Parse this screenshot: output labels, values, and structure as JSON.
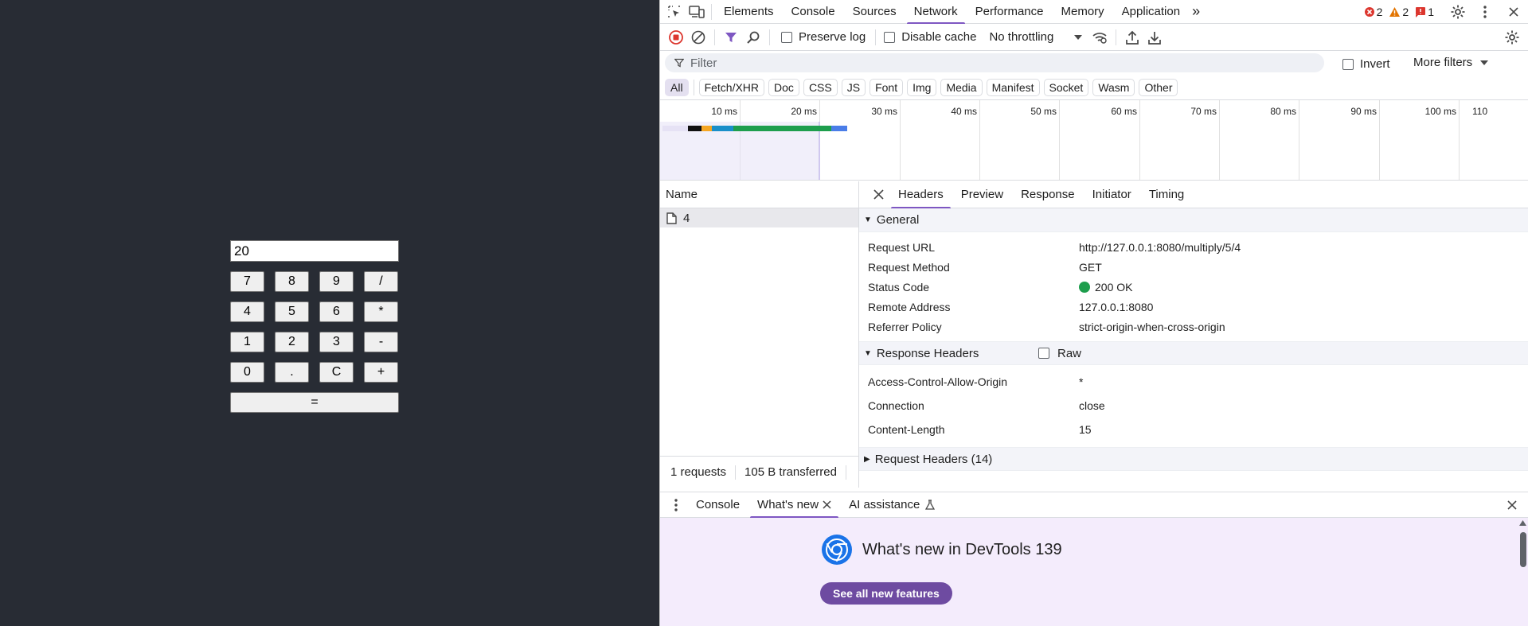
{
  "calculator": {
    "display": "20",
    "rows": [
      [
        "7",
        "8",
        "9",
        "/"
      ],
      [
        "4",
        "5",
        "6",
        "*"
      ],
      [
        "1",
        "2",
        "3",
        "-"
      ],
      [
        "0",
        ".",
        "C",
        "+"
      ]
    ],
    "equals": "="
  },
  "devtools": {
    "main_tabs": [
      "Elements",
      "Console",
      "Sources",
      "Network",
      "Performance",
      "Memory",
      "Application"
    ],
    "active_tab": "Network",
    "more_tabs": "»",
    "errors": "2",
    "warnings": "2",
    "issues": "1",
    "toolbar": {
      "preserve_log": "Preserve log",
      "disable_cache": "Disable cache",
      "throttling": "No throttling"
    },
    "filter": {
      "placeholder": "Filter",
      "invert": "Invert",
      "more_filters": "More filters"
    },
    "types": [
      "All",
      "Fetch/XHR",
      "Doc",
      "CSS",
      "JS",
      "Font",
      "Img",
      "Media",
      "Manifest",
      "Socket",
      "Wasm",
      "Other"
    ],
    "timeline_ticks": [
      "10 ms",
      "20 ms",
      "30 ms",
      "40 ms",
      "50 ms",
      "60 ms",
      "70 ms",
      "80 ms",
      "90 ms",
      "100 ms",
      "110"
    ],
    "request_list": {
      "header": "Name",
      "rows": [
        "4"
      ],
      "status_requests": "1 requests",
      "status_transferred": "105 B transferred"
    },
    "details_tabs": [
      "Headers",
      "Preview",
      "Response",
      "Initiator",
      "Timing"
    ],
    "general": {
      "title": "General",
      "rows": [
        {
          "k": "Request URL",
          "v": "http://127.0.0.1:8080/multiply/5/4"
        },
        {
          "k": "Request Method",
          "v": "GET"
        },
        {
          "k": "Status Code",
          "v": "200 OK"
        },
        {
          "k": "Remote Address",
          "v": "127.0.0.1:8080"
        },
        {
          "k": "Referrer Policy",
          "v": "strict-origin-when-cross-origin"
        }
      ]
    },
    "response_headers": {
      "title": "Response Headers",
      "raw": "Raw",
      "rows": [
        {
          "k": "Access-Control-Allow-Origin",
          "v": "*"
        },
        {
          "k": "Connection",
          "v": "close"
        },
        {
          "k": "Content-Length",
          "v": "15"
        }
      ]
    },
    "request_headers": {
      "title": "Request Headers (14)"
    },
    "drawer": {
      "tabs": [
        "Console",
        "What's new",
        "AI assistance"
      ],
      "active": "What's new",
      "title": "What's new in DevTools 139",
      "button": "See all new features"
    },
    "colors": {
      "accent": "#7e57c2",
      "status_ok": "#1e9e4d",
      "error": "#dc362e",
      "warning": "#e37400"
    }
  }
}
